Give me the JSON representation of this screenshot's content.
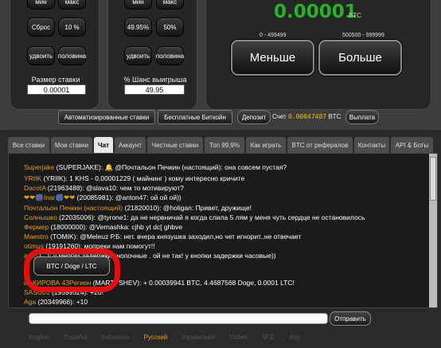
{
  "left_panel": {
    "buttons": [
      "мин",
      "макс",
      "Сброс",
      "10 %",
      "удвоить",
      "половина"
    ],
    "label": "Размер ставки",
    "value": "0.00001"
  },
  "mid_panel": {
    "buttons": [
      "мин",
      "макс",
      "49.95%",
      "50%",
      "удвоить",
      "половина"
    ],
    "label": "% Шанс выигрыша",
    "value": "49.95"
  },
  "game": {
    "result": "0.00001",
    "result_unit": "BTC",
    "range_low": "0 - 499499",
    "range_high": "500500 - 999999",
    "low_button": "Меньше",
    "high_button": "Больше"
  },
  "bar": {
    "auto_bets": "Автоматизированные ставки",
    "free_btc": "Бесплатные Биткойн",
    "deposit": "Депозит",
    "account_label": "Счет",
    "balance": "0.00047487",
    "balance_unit": "BTC",
    "withdraw": "Выплата"
  },
  "tabs": [
    "Все ставки",
    "Мои ставки",
    "Чат",
    "Аккаунт",
    "Честные ставки",
    "Топ 99,9%",
    "Как играть",
    "BTC от рефералов",
    "Контакты",
    "API & Боты"
  ],
  "active_tab": "Чат",
  "chat": {
    "messages": [
      {
        "name": "Superjake",
        "text": " (SUPERJAKE): 🔔 @Почтальон Печкин (настоящий): она совсем пустая?"
      },
      {
        "name": "YRIIK",
        "text": " (YRIIK): 1 KHS - 0.00001229 ( майнинг ) кому интересно кричите"
      },
      {
        "name": "DacotA",
        "text": " (21963488): @slava10: чем то мотивируют?"
      },
      {
        "name": "❤❤🎆Inar🎆❤❤",
        "text": " (20085981): @anton47: ой ой ой))"
      },
      {
        "name": "Почтальон Печкин (настоящий)",
        "text": " (21820010): @holigan: Привет, дружище!"
      },
      {
        "name": "Солнышко",
        "text": " (22035006): @tyrone1: да не нервничай я когда слила 5 лям у меня чуть сердце не остановилось"
      },
      {
        "name": "Фермер",
        "text": " (18000000): @Vernashka: cjhb yt dc[ ghbve"
      },
      {
        "name": "Maestro",
        "text": " (TOMIK): @Meleuz Р.Б: нет. вчера князушка заходил,но чет игнорит..не отвечает"
      },
      {
        "name": "otimus",
        "text": " (19191260): мопреки нам помогут!!"
      },
      {
        "name": "arah",
        "text": " (...): у многих задержки кнопочные . ой не так! у кнопки задержки часовые))"
      },
      {
        "name": "из КИРОВА 43Регион",
        "text": " (MARTYSHEV): + 0.00039941 BTC, 4.4687568 Doge, 0.0001 LTC!"
      },
      {
        "name": "SASU01",
        "text": " (19599524): +20!"
      },
      {
        "name": "Aga",
        "text": " (20349966): +10"
      }
    ],
    "coin_selector": "BTC / Doge / LTC",
    "input_value": "",
    "send_button": "Отправить"
  },
  "languages": [
    "English",
    "Español",
    "Indonesia",
    "Русский",
    "Українській",
    "Uzbek",
    "中文",
    "Any"
  ],
  "selected_language": "Русский",
  "colors": {
    "accent_green": "#2bb02b",
    "balance_yellow": "#f0c000",
    "name_orange": "#e59a1a",
    "highlight_red": "#e01010"
  }
}
